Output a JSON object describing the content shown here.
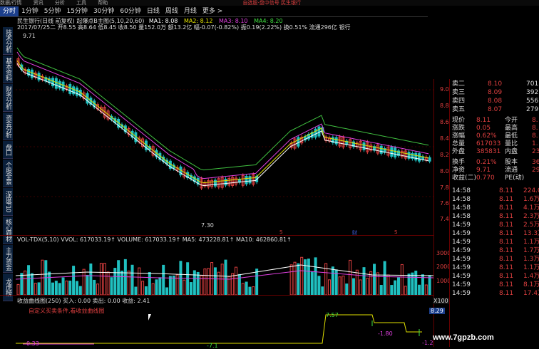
{
  "topbar": {
    "items": [
      "数据/行情",
      "资讯",
      "分析",
      "工具",
      "帮助"
    ],
    "alert": "自选股·盘中信号  民生银行"
  },
  "tabs": [
    "分时",
    "1分钟",
    "5分钟",
    "15分钟",
    "30分钟",
    "60分钟",
    "日线",
    "周线",
    "月线",
    "更多 >"
  ],
  "sidebar": [
    "技术分析",
    "基本资料",
    "财务分析",
    "资金分析",
    "盘口",
    "个股全景",
    "深度F10",
    "核心题材",
    "主力资金",
    "龙虎榜"
  ],
  "main": {
    "title": "民生银行(日线 前复权) 起爆点B主图(5,10,20,60)",
    "ma": [
      {
        "label": "MA1: 8.08",
        "color": "#ffffff"
      },
      {
        "label": "MA2: 8.12",
        "color": "#e0e000"
      },
      {
        "label": "MA3: 8.10",
        "color": "#e040e0"
      },
      {
        "label": "MA4: 8.20",
        "color": "#40e040"
      }
    ],
    "info": "2017/07/25二 开8.55 高8.64 低8.45 收8.50 量152.0万 额13.2亿 幅-0.07(-0.82%) 振0.19(2.22%) 换0.51% 流通296亿 银行",
    "high_label": "9.71",
    "low_label": "7.30",
    "yaxis": [
      "9.00",
      "8.80",
      "8.60",
      "8.40",
      "8.20",
      "8.00",
      "7.80",
      "7.60",
      "7.40"
    ],
    "marks": [
      "S",
      "财",
      "S"
    ]
  },
  "volume": {
    "header": "VOL-TDX(5,10) VVOL: 617033.19↑ VOLUME: 617033.19↑ MA5: 473228.81↑ MA10: 462860.81↑",
    "yaxis": [
      "30000",
      "20000",
      "10000",
      "X100"
    ]
  },
  "indicator": {
    "header": "收益曲线图(250) 买入: 0.00 卖出: 0.00 收益: 2.41",
    "note": "自定义买卖条件,看收益曲线图",
    "labels": [
      "7.57",
      "-1.80",
      "-1.2",
      "0.33",
      "-7.1"
    ],
    "price_tag": "8.29"
  },
  "quote": {
    "asks": [
      {
        "label": "卖二",
        "price": "8.10",
        "vol": "701"
      },
      {
        "label": "卖三",
        "price": "8.09",
        "vol": "392"
      },
      {
        "label": "卖四",
        "price": "8.08",
        "vol": "556"
      },
      {
        "label": "卖五",
        "price": "8.07",
        "vol": "279"
      }
    ],
    "stats": [
      {
        "l": "现价",
        "m": "8.11",
        "r": "今开",
        "rv": "8."
      },
      {
        "l": "涨跌",
        "m": "0.05",
        "r": "最高",
        "rv": "8."
      },
      {
        "l": "涨幅",
        "m": "0.62%",
        "r": "最低",
        "rv": "8."
      },
      {
        "l": "总量",
        "m": "617033",
        "r": "量比",
        "rv": "1."
      },
      {
        "l": "外盘",
        "m": "385831",
        "r": "内盘",
        "rv": "231"
      },
      {
        "l": "换手",
        "m": "0.21%",
        "r": "股本",
        "rv": "36"
      },
      {
        "l": "净资",
        "m": "9.71",
        "r": "流通",
        "rv": "29"
      },
      {
        "l": "收益(二)",
        "m": "0.770",
        "r": "PE(动)",
        "rv": ""
      }
    ],
    "trades": [
      {
        "t": "14:58",
        "p": "8.11",
        "v": "224.0万",
        "c": "#e04040"
      },
      {
        "t": "14:58",
        "p": "8.11",
        "v": "1.6万",
        "c": "#e04040"
      },
      {
        "t": "14:58",
        "p": "8.11",
        "v": "4.1万",
        "c": "#e04040"
      },
      {
        "t": "14:58",
        "p": "8.11",
        "v": "2.3万",
        "c": "#e04040"
      },
      {
        "t": "14:59",
        "p": "8.11",
        "v": "2.5万",
        "c": "#e04040"
      },
      {
        "t": "14:59",
        "p": "8.11",
        "v": "13.3万",
        "c": "#e04040"
      },
      {
        "t": "14:59",
        "p": "8.11",
        "v": "1.1万",
        "c": "#e04040"
      },
      {
        "t": "14:59",
        "p": "8.11",
        "v": "1.7万",
        "c": "#e04040"
      },
      {
        "t": "14:59",
        "p": "8.11",
        "v": "1.3万",
        "c": "#e04040"
      },
      {
        "t": "14:59",
        "p": "8.11",
        "v": "1.1万",
        "c": "#e04040"
      },
      {
        "t": "14:59",
        "p": "8.11",
        "v": "1.4万",
        "c": "#e04040"
      },
      {
        "t": "14:59",
        "p": "8.11",
        "v": "8.1万",
        "c": "#e04040"
      },
      {
        "t": "14:59",
        "p": "8.11",
        "v": "17.4万",
        "c": "#e04040"
      }
    ]
  },
  "watermark": "www.7gpzb.com"
}
